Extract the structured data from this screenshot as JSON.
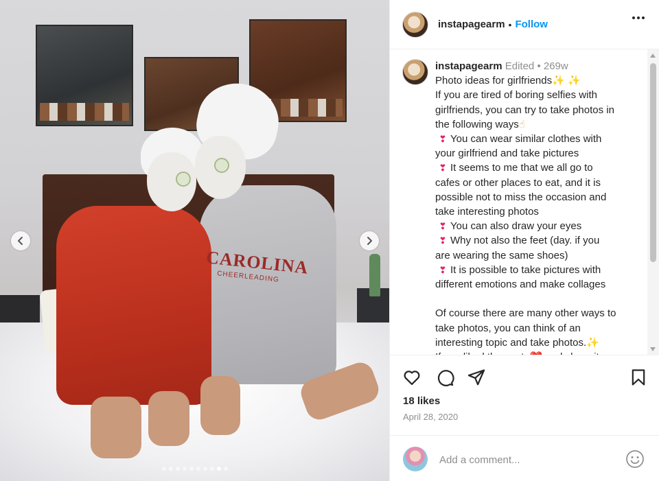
{
  "post": {
    "username": "instapagearm",
    "separator": "•",
    "follow_label": "Follow",
    "more_icon": "more-horizontal-icon"
  },
  "media": {
    "prev_icon": "chevron-left-icon",
    "next_icon": "chevron-right-icon",
    "carousel_count": 10,
    "carousel_active_index": 8,
    "sweatshirt_text": "CAROLINA",
    "sweatshirt_subtext": "CHEERLEADING"
  },
  "caption": {
    "username": "instapagearm",
    "edited": "Edited",
    "dot": "•",
    "age": "269w",
    "lines": [
      {
        "text": "Photo ideas for girlfriends",
        "suffix": "✨ ✨",
        "suffix_type": "spark"
      },
      {
        "text": "If you are tired of boring selfies with"
      },
      {
        "text": "girlfriends, you can try to take photos in"
      },
      {
        "text": "the following ways",
        "suffix": "☝",
        "suffix_type": "hand"
      },
      {
        "prefix": "❣",
        "text": "You can wear similar clothes with"
      },
      {
        "text": "your girlfriend and take pictures"
      },
      {
        "prefix": "❣",
        "text": "It seems to me that we all go to"
      },
      {
        "text": "cafes or other places to eat, and it is"
      },
      {
        "text": "possible not to miss the occasion and"
      },
      {
        "text": "take interesting photos"
      },
      {
        "prefix": "❣",
        "text": "You can also draw your eyes"
      },
      {
        "prefix": "❣",
        "text": "Why not also the feet (day. if you"
      },
      {
        "text": "are wearing the same shoes)"
      },
      {
        "prefix": "❣",
        "text": "It is possible to take pictures with"
      },
      {
        "text": "different emotions and make collages"
      },
      {
        "text": " "
      },
      {
        "text": "Of course there are many other ways to"
      },
      {
        "text": "take photos, you can think of an"
      },
      {
        "text": "interesting topic and take photos.",
        "suffix": "✨",
        "suffix_type": "spark"
      },
      {
        "text": "If you liked the post, ❤️ and share it"
      }
    ]
  },
  "actions": {
    "like_icon": "heart-icon",
    "comment_icon": "comment-icon",
    "share_icon": "share-icon",
    "save_icon": "bookmark-icon"
  },
  "stats": {
    "likes": "18 likes",
    "date": "April 28, 2020"
  },
  "comment": {
    "placeholder": "Add a comment...",
    "emoji_icon": "smiley-icon"
  },
  "colors": {
    "accent": "#0095f6",
    "text": "#262626",
    "muted": "#8e8e8e",
    "heart": "#e0245e"
  }
}
